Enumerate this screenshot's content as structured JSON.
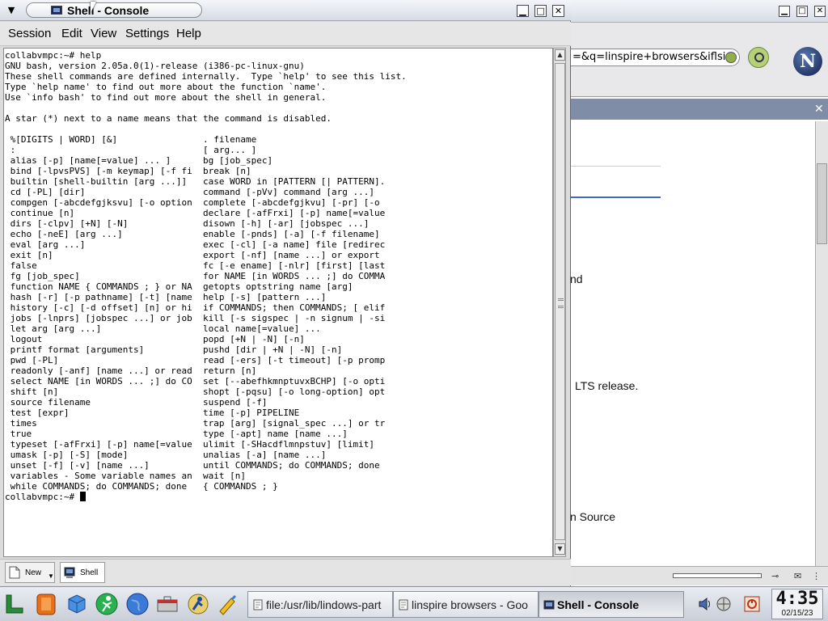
{
  "console": {
    "title": "Shell - Console",
    "menu": [
      "Session",
      "Edit",
      "View",
      "Settings",
      "Help"
    ],
    "lines": [
      "collabvmpc:~# help",
      "GNU bash, version 2.05a.0(1)-release (i386-pc-linux-gnu)",
      "These shell commands are defined internally.  Type `help' to see this list.",
      "Type `help name' to find out more about the function `name'.",
      "Use `info bash' to find out more about the shell in general.",
      "",
      "A star (*) next to a name means that the command is disabled.",
      "",
      " %[DIGITS | WORD] [&]                . filename",
      " :                                   [ arg... ]",
      " alias [-p] [name[=value] ... ]      bg [job_spec]",
      " bind [-lpvsPVS] [-m keymap] [-f fi  break [n]",
      " builtin [shell-builtin [arg ...]]   case WORD in [PATTERN [| PATTERN].",
      " cd [-PL] [dir]                      command [-pVv] command [arg ...]",
      " compgen [-abcdefgjksvu] [-o option  complete [-abcdefgjkvu] [-pr] [-o",
      " continue [n]                        declare [-afFrxi] [-p] name[=value",
      " dirs [-clpv] [+N] [-N]              disown [-h] [-ar] [jobspec ...]",
      " echo [-neE] [arg ...]               enable [-pnds] [-a] [-f filename]",
      " eval [arg ...]                      exec [-cl] [-a name] file [redirec",
      " exit [n]                            export [-nf] [name ...] or export",
      " false                               fc [-e ename] [-nlr] [first] [last",
      " fg [job_spec]                       for NAME [in WORDS ... ;] do COMMA",
      " function NAME { COMMANDS ; } or NA  getopts optstring name [arg]",
      " hash [-r] [-p pathname] [-t] [name  help [-s] [pattern ...]",
      " history [-c] [-d offset] [n] or hi  if COMMANDS; then COMMANDS; [ elif",
      " jobs [-lnprs] [jobspec ...] or job  kill [-s sigspec | -n signum | -si",
      " let arg [arg ...]                   local name[=value] ...",
      " logout                              popd [+N | -N] [-n]",
      " printf format [arguments]           pushd [dir | +N | -N] [-n]",
      " pwd [-PL]                           read [-ers] [-t timeout] [-p promp",
      " readonly [-anf] [name ...] or read  return [n]",
      " select NAME [in WORDS ... ;] do CO  set [--abefhkmnptuvxBCHP] [-o opti",
      " shift [n]                           shopt [-pqsu] [-o long-option] opt",
      " source filename                     suspend [-f]",
      " test [expr]                         time [-p] PIPELINE",
      " times                               trap [arg] [signal_spec ...] or tr",
      " true                                type [-apt] name [name ...]",
      " typeset [-afFrxi] [-p] name[=value  ulimit [-SHacdflmnpstuv] [limit]",
      " umask [-p] [-S] [mode]              unalias [-a] [name ...]",
      " unset [-f] [-v] [name ...]          until COMMANDS; do COMMANDS; done",
      " variables - Some variable names an  wait [n]",
      " while COMMANDS; do COMMANDS; done   { COMMANDS ; }"
    ],
    "prompt": "collabvmpc:~# ",
    "session_tabs": [
      {
        "label": "New",
        "icon": "new-session-icon"
      },
      {
        "label": "Shell",
        "icon": "terminal-icon"
      }
    ]
  },
  "browser_bg": {
    "url_text": "=&q=linspire+browsers&iflsi",
    "logo_letter": "N",
    "content_fragments": [
      "nd",
      "LTS release.",
      "n Source"
    ]
  },
  "taskbar": {
    "launchers": [
      "lindows-start-icon",
      "lifebuoy-icon",
      "cube-icon",
      "runner-icon",
      "globe-icon",
      "toolbox-icon",
      "click-n-run-icon",
      "paint-icon"
    ],
    "tasks": [
      {
        "label": "file:/usr/lib/lindows-part",
        "active": false,
        "icon": "folder-icon"
      },
      {
        "label": "linspire browsers - Goo",
        "active": false,
        "icon": "browser-icon"
      },
      {
        "label": "Shell - Console",
        "active": true,
        "icon": "terminal-icon"
      }
    ],
    "tray": [
      "volume-icon",
      "network-icon",
      "power-icon"
    ],
    "clock": {
      "time": "4:35",
      "date": "02/15/23"
    }
  },
  "colors": {
    "accent": "#4466cc",
    "panel": "#7f8ea6"
  }
}
